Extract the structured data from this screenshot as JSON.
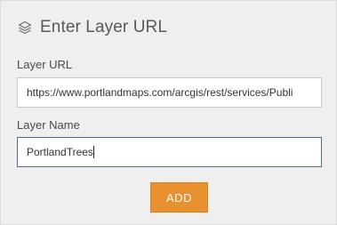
{
  "header": {
    "title": "Enter Layer URL",
    "icon": "layers-icon"
  },
  "form": {
    "url_label": "Layer URL",
    "url_value": "https://www.portlandmaps.com/arcgis/rest/services/Publi",
    "name_label": "Layer Name",
    "name_value": "PortlandTrees"
  },
  "actions": {
    "add_label": "ADD"
  },
  "colors": {
    "accent": "#e9912f",
    "panel_bg": "#efefef",
    "focus_border": "#4f6a8a"
  }
}
